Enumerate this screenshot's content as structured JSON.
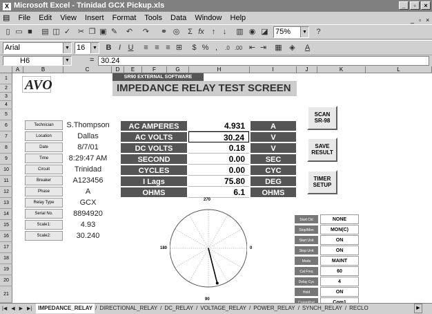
{
  "window": {
    "title": "Microsoft Excel - Trinidad GCX Pickup.xls",
    "app_icon": "X"
  },
  "menu": [
    "File",
    "Edit",
    "View",
    "Insert",
    "Format",
    "Tools",
    "Data",
    "Window",
    "Help"
  ],
  "toolbar": {
    "zoom": "75%",
    "font_name": "Arial",
    "font_size": "16",
    "bold": "B",
    "italic": "I",
    "underline": "U",
    "percent": "%",
    "comma": ",",
    "currency": "$",
    "sigma": "Σ",
    "fx": "fx",
    "dec_inc": ".0",
    "dec_dec": ".00",
    "font_color": "A"
  },
  "formula_bar": {
    "cell_ref": "H6",
    "equals": "=",
    "value": "30.24"
  },
  "columns": [
    "A",
    "B",
    "C",
    "D",
    "E",
    "F",
    "G",
    "H",
    "I",
    "J",
    "K",
    "L"
  ],
  "rows": [
    "1",
    "2",
    "3",
    "4",
    "5",
    "6",
    "7",
    "8",
    "9",
    "10",
    "11",
    "12",
    "13",
    "14",
    "15",
    "16",
    "17",
    "18",
    "19",
    "20",
    "21"
  ],
  "logo": "AVO",
  "header": {
    "subtitle": "SR90 EXTERNAL SOFTWARE",
    "title": "IMPEDANCE RELAY TEST SCREEN"
  },
  "info": [
    {
      "label": "Technician",
      "value": "S.Thompson"
    },
    {
      "label": "Location",
      "value": "Dallas"
    },
    {
      "label": "Date",
      "value": "8/7/01"
    },
    {
      "label": "Time",
      "value": "8:29:47 AM"
    },
    {
      "label": "Circuit",
      "value": "Trinidad"
    },
    {
      "label": "Breaker",
      "value": "A123456"
    },
    {
      "label": "Phase",
      "value": "A"
    },
    {
      "label": "Relay Type",
      "value": "GCX"
    },
    {
      "label": "Serial No.",
      "value": "8894920"
    },
    {
      "label": "Scale1:",
      "value": "4.93"
    },
    {
      "label": "Scale2:",
      "value": "30.240"
    }
  ],
  "measurements": [
    {
      "label": "AC AMPERES",
      "value": "4.931",
      "unit": "A"
    },
    {
      "label": "AC VOLTS",
      "value": "30.24",
      "unit": "V"
    },
    {
      "label": "DC VOLTS",
      "value": "0.18",
      "unit": "V"
    },
    {
      "label": "SECOND",
      "value": "0.00",
      "unit": "SEC"
    },
    {
      "label": "CYCLES",
      "value": "0.00",
      "unit": "CYC"
    },
    {
      "label": "I Lags",
      "value": "75.80",
      "unit": "DEG"
    },
    {
      "label": "OHMS",
      "value": "6.1",
      "unit": "OHMS"
    }
  ],
  "buttons": {
    "scan": [
      "SCAN",
      "SR-98"
    ],
    "save": [
      "SAVE",
      "RESULT"
    ],
    "timer": [
      "TIMER",
      "SETUP"
    ]
  },
  "polar": {
    "label_top": "270",
    "label_left": "180",
    "label_right": "0",
    "label_bottom": "90",
    "angle_deg": 75.8
  },
  "settings": [
    {
      "label": "Start Ckt",
      "value": "NONE"
    },
    {
      "label": "Stop/Mon",
      "value": "MON(C)"
    },
    {
      "label": "Start Unit",
      "value": "ON"
    },
    {
      "label": "Stop Unit",
      "value": "ON"
    },
    {
      "label": "Mode",
      "value": "MAINT"
    },
    {
      "label": "Cal Freq",
      "value": "60"
    },
    {
      "label": "Delay Cyc",
      "value": "4"
    },
    {
      "label": "Hold",
      "value": "ON"
    },
    {
      "label": "CommPort",
      "value": "Com1"
    }
  ],
  "sheet_tabs": [
    "IMPEDANCE_RELAY",
    "DIRECTIONAL_RELAY",
    "DC_RELAY",
    "VOLTAGE_RELAY",
    "POWER_RELAY",
    "SYNCH_RELAY",
    "RECLO"
  ]
}
